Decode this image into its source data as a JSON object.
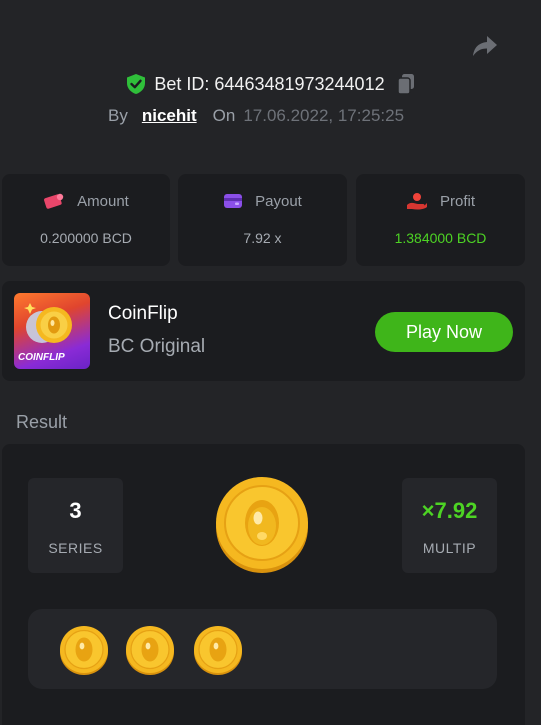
{
  "header": {
    "bet_id_text": "Bet ID: 64463481973244012",
    "by_label": "By",
    "username": "nicehit",
    "on_label": "On",
    "date": "17.06.2022, 17:25:25"
  },
  "stats": [
    {
      "label": "Amount",
      "value": "0.200000 BCD",
      "icon": "amount-icon"
    },
    {
      "label": "Payout",
      "value": "7.92 x",
      "icon": "wallet-icon"
    },
    {
      "label": "Profit",
      "value": "1.384000 BCD",
      "icon": "profit-icon"
    }
  ],
  "game": {
    "thumb_label": "COINFLIP",
    "title": "CoinFlip",
    "subtitle": "BC Original",
    "play_label": "Play Now"
  },
  "result": {
    "section_label": "Result",
    "series_value": "3",
    "series_label": "SERIES",
    "multip_value": "×7.92",
    "multip_label": "MULTIP",
    "history_count": 3
  },
  "colors": {
    "background": "#232427",
    "card": "#1b1c1f",
    "green": "#4dd324",
    "button_green": "#3fb51a",
    "coin_gold": "#f5b820"
  }
}
